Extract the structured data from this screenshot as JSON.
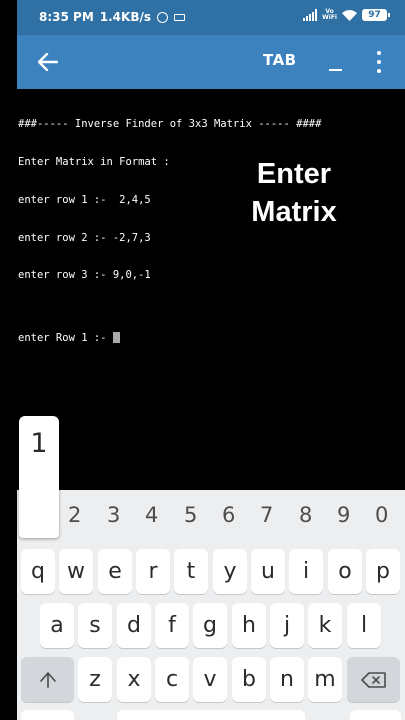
{
  "status_bar": {
    "time": "8:35 PM",
    "net_speed": "1.4KB/s",
    "volte_top": "Vo",
    "volte_bottom": "WiFi",
    "battery": "97"
  },
  "toolbar": {
    "back_icon": "arrow-left-icon",
    "tab_label": "TAB",
    "menu_icon": "more-vert-icon"
  },
  "terminal": {
    "lines": [
      "###----- Inverse Finder of 3x3 Matrix ----- ####",
      "Enter Matrix in Format :",
      "enter row 1 :-  2,4,5",
      "enter row 2 :- -2,7,3",
      "enter row 3 :- 9,0,-1",
      "",
      "enter Row 1 :-"
    ]
  },
  "overlay": {
    "line1": "Enter",
    "line2": "Matrix"
  },
  "keyboard": {
    "preview_key": "1",
    "number_row": [
      "2",
      "3",
      "4",
      "5",
      "6",
      "7",
      "8",
      "9",
      "0"
    ],
    "row1": [
      "q",
      "w",
      "e",
      "r",
      "t",
      "y",
      "u",
      "i",
      "o",
      "p"
    ],
    "row2": [
      "a",
      "s",
      "d",
      "f",
      "g",
      "h",
      "j",
      "k",
      "l"
    ],
    "row3": [
      "z",
      "x",
      "c",
      "v",
      "b",
      "n",
      "m"
    ],
    "shift_icon": "shift-arrow-icon",
    "backspace_icon": "backspace-icon"
  },
  "colors": {
    "status_bar": "#2f71a4",
    "toolbar": "#3b82bf",
    "terminal_bg": "#000000",
    "keyboard_bg": "#eceef0"
  }
}
